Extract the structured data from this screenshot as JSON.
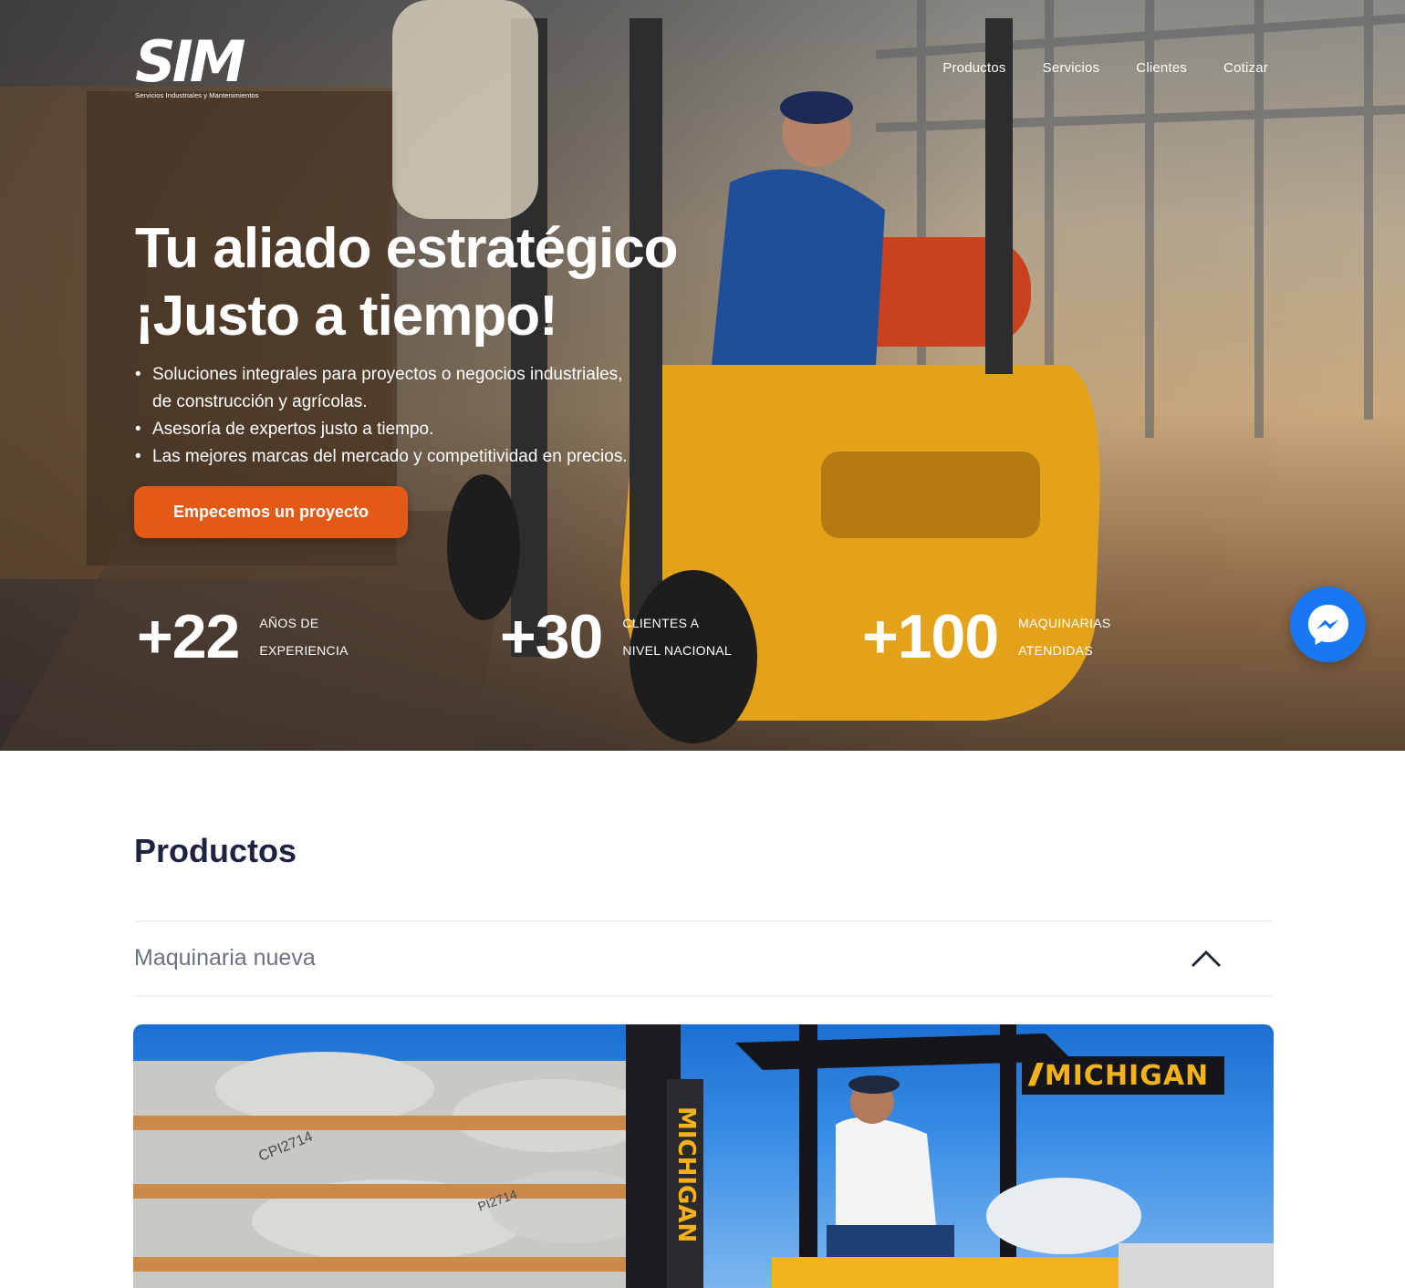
{
  "logo": {
    "text": "SIM",
    "subtitle": "Servicios Industriales y Mantenimientos"
  },
  "nav": {
    "items": [
      "Productos",
      "Servicios",
      "Clientes",
      "Cotizar"
    ]
  },
  "hero": {
    "headline_line1": "Tu aliado estratégico",
    "headline_line2": "¡Justo a tiempo!",
    "bullets": [
      "Soluciones integrales para proyectos o negocios industriales,",
      "de construcción y agrícolas.",
      "Asesoría de expertos justo a tiempo.",
      "Las mejores marcas del mercado y competitividad en precios."
    ],
    "cta_label": "Empecemos un proyecto",
    "stats": [
      {
        "number": "+22",
        "label_line1": "AÑOS DE",
        "label_line2": "EXPERIENCIA"
      },
      {
        "number": "+30",
        "label_line1": "CLIENTES A",
        "label_line2": "NIVEL NACIONAL"
      },
      {
        "number": "+100",
        "label_line1": "MAQUINARIAS",
        "label_line2": "ATENDIDAS"
      }
    ]
  },
  "products": {
    "title": "Productos",
    "accordion_label": "Maquinaria nueva",
    "banner_brand": "MICHIGAN",
    "mast_text": "MICHIGAN",
    "block_codes": [
      "CPI2714",
      "PI2714"
    ]
  },
  "colors": {
    "accent": "#e35a17",
    "title": "#1d2340",
    "messenger": "#1877f2",
    "brand_yellow": "#f3b21a"
  }
}
